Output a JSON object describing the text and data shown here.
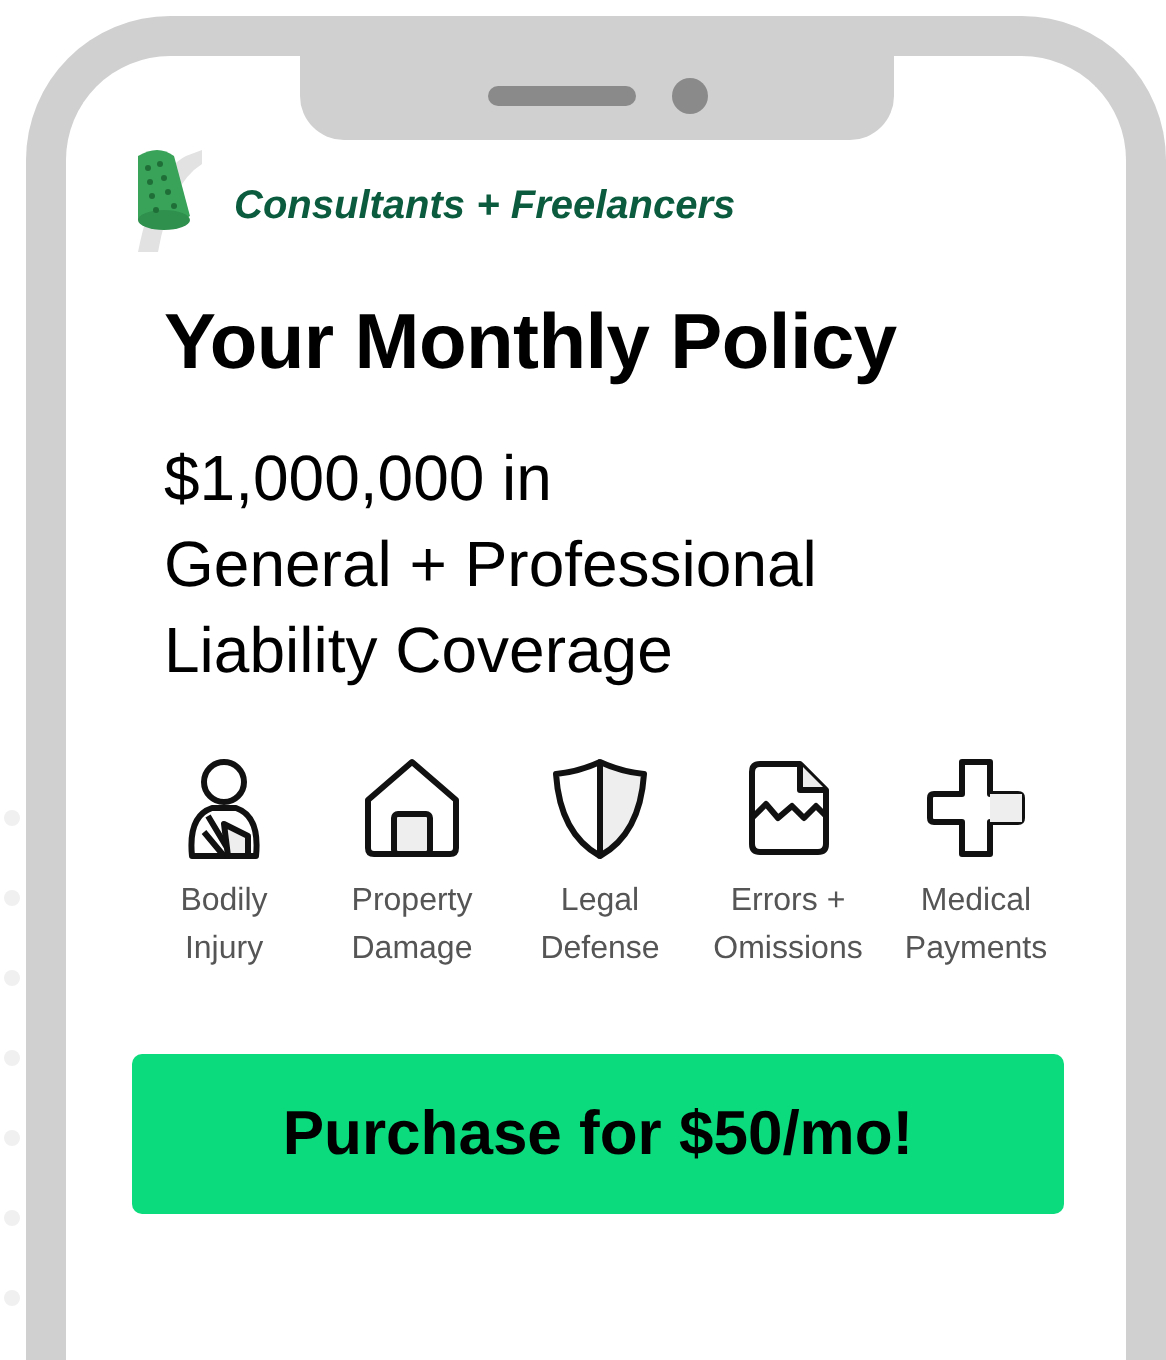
{
  "brand": {
    "label": "Consultants + Freelancers"
  },
  "title": "Your Monthly Policy",
  "coverage_lines": [
    "$1,000,000 in",
    "General + Professional",
    "Liability Coverage"
  ],
  "coverages": [
    {
      "kind": "person",
      "label": "Bodily Injury"
    },
    {
      "kind": "house",
      "label": "Property Damage"
    },
    {
      "kind": "shield",
      "label": "Legal Defense"
    },
    {
      "kind": "document",
      "label": "Errors + Omissions"
    },
    {
      "kind": "cross",
      "label": "Medical Payments"
    }
  ],
  "button": "Purchase for $50/mo!"
}
